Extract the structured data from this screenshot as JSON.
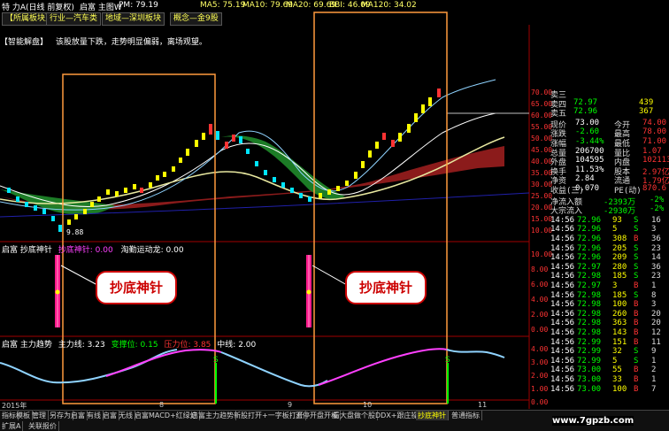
{
  "window": {
    "title_left": "特 力A(日线 前复权)",
    "title_mid": "启富 主图W",
    "pm": "PM: 79.19",
    "ma5": "MA5: 75.19",
    "ma10": "MA10: 79.69",
    "ma20": "MA20: 69.69",
    "bbi": "BBI: 46.09",
    "ma120": "MA120: 34.02"
  },
  "tabs": [
    {
      "label": "【所属板块】"
    },
    {
      "label": "行业—汽车类"
    },
    {
      "label": "地域—深圳板块"
    },
    {
      "label": "概念—金9股"
    }
  ],
  "notice": {
    "prefix": "【智能解盘】",
    "text": "该股放量下跌，走势明显偏弱，离场观望。"
  },
  "main_axis": [
    "70.00",
    "65.00",
    "60.00",
    "55.00",
    "50.00",
    "45.00",
    "40.00",
    "35.00",
    "30.00",
    "25.00",
    "20.00",
    "15.00",
    "10.00"
  ],
  "low_label": "9.88",
  "ind1": {
    "name": "启富 抄底神针",
    "a_label": "抄底神针:",
    "a_value": "0.00",
    "b_label": "淘勤运动龙:",
    "b_value": "0.00",
    "axis": [
      "10.00",
      "8.00",
      "6.00",
      "4.00",
      "2.00",
      "0.00"
    ],
    "callout1": "抄底神针",
    "callout2": "抄底神针"
  },
  "ind2": {
    "name": "启富 主力趋势",
    "main_label": "主力线:",
    "main_value": "3.23",
    "change_label": "变撑位:",
    "change_value": "0.15",
    "press_label": "压力位:",
    "press_value": "3.85",
    "mid_label": "中线:",
    "mid_value": "2.00",
    "axis": [
      "4.00",
      "3.00",
      "2.00",
      "1.00",
      "0.00"
    ],
    "s_marker": "S"
  },
  "date_axis": {
    "year": "2015年",
    "m8": "8",
    "m9": "9",
    "m10": "10",
    "m11": "11"
  },
  "quotes": {
    "sell": [
      {
        "label": "卖三",
        "price": "",
        "vol": ""
      },
      {
        "label": "卖四",
        "price": "72.97",
        "vol": "439"
      },
      {
        "label": "卖五",
        "price": "72.96",
        "vol": "367"
      }
    ],
    "stats": [
      {
        "l1": "现价",
        "v1": "73.00",
        "l2": "今开",
        "v2": "74.00"
      },
      {
        "l1": "涨跌",
        "v1": "-2.60",
        "l2": "最高",
        "v2": "78.00"
      },
      {
        "l1": "涨幅",
        "v1": "-3.44%",
        "l2": "最低",
        "v2": "71.00"
      },
      {
        "l1": "总量",
        "v1": "206700",
        "l2": "量比",
        "v2": "1.07"
      },
      {
        "l1": "外盘",
        "v1": "104595",
        "l2": "内盘",
        "v2": "102113"
      },
      {
        "l1": "换手",
        "v1": "11.53%",
        "l2": "股本",
        "v2": "2.97亿"
      },
      {
        "l1": "净资",
        "v1": "2.84",
        "l2": "流通",
        "v2": "1.79亿"
      },
      {
        "l1": "收益(三)",
        "v1": "0.070",
        "l2": "PE(动)",
        "v2": "870.6"
      }
    ],
    "flows": [
      {
        "label": "净流入额",
        "value": "-2393万",
        "pct": "-2%"
      },
      {
        "label": "大宗流入",
        "value": "-2930万",
        "pct": "-2%"
      }
    ],
    "ticks": [
      {
        "time": "14:56",
        "price": "72.96",
        "vol": "93",
        "side": "S",
        "n": "16"
      },
      {
        "time": "14:56",
        "price": "72.96",
        "vol": "5",
        "side": "S",
        "n": "3"
      },
      {
        "time": "14:56",
        "price": "72.96",
        "vol": "308",
        "side": "B",
        "n": "36"
      },
      {
        "time": "14:56",
        "price": "72.96",
        "vol": "205",
        "side": "S",
        "n": "23"
      },
      {
        "time": "14:56",
        "price": "72.96",
        "vol": "209",
        "side": "S",
        "n": "14"
      },
      {
        "time": "14:56",
        "price": "72.97",
        "vol": "280",
        "side": "S",
        "n": "36"
      },
      {
        "time": "14:56",
        "price": "72.98",
        "vol": "185",
        "side": "S",
        "n": "23"
      },
      {
        "time": "14:56",
        "price": "72.97",
        "vol": "3",
        "side": "B",
        "n": "1"
      },
      {
        "time": "14:56",
        "price": "72.98",
        "vol": "185",
        "side": "S",
        "n": "8"
      },
      {
        "time": "14:56",
        "price": "72.98",
        "vol": "100",
        "side": "B",
        "n": "3"
      },
      {
        "time": "14:56",
        "price": "72.98",
        "vol": "260",
        "side": "B",
        "n": "20"
      },
      {
        "time": "14:56",
        "price": "72.98",
        "vol": "363",
        "side": "B",
        "n": "20"
      },
      {
        "time": "14:56",
        "price": "72.98",
        "vol": "143",
        "side": "B",
        "n": "12"
      },
      {
        "time": "14:56",
        "price": "72.99",
        "vol": "151",
        "side": "B",
        "n": "11"
      },
      {
        "time": "14:56",
        "price": "72.99",
        "vol": "32",
        "side": "S",
        "n": "9"
      },
      {
        "time": "14:56",
        "price": "72.99",
        "vol": "5",
        "side": "S",
        "n": "1"
      },
      {
        "time": "14:56",
        "price": "73.00",
        "vol": "55",
        "side": "B",
        "n": "2"
      },
      {
        "time": "14:56",
        "price": "73.00",
        "vol": "33",
        "side": "B",
        "n": "1"
      },
      {
        "time": "14:56",
        "price": "73.00",
        "vol": "100",
        "side": "B",
        "n": "7"
      }
    ]
  },
  "bottom_buttons": [
    "指标",
    "模板",
    "管理",
    "另存为",
    "启富",
    "有线",
    "启富",
    "无线",
    "启富MACD+红绿灯",
    "启富主力趋势",
    "新股打开+一字板打开",
    "涨停开盘开板",
    "看大盘做个股",
    "DDX+跟庄操盘",
    "抄底神针",
    "普通指标"
  ],
  "bottom_active": 14,
  "bottom2": [
    "扩展A",
    "关联报价"
  ],
  "watermark": "www.7gpzb.com",
  "colors": {
    "up": "#ff3333",
    "down": "#00e5ff",
    "yellow": "#ffff00",
    "pink": "#ff00ff",
    "orange": "#ff9a3d"
  }
}
